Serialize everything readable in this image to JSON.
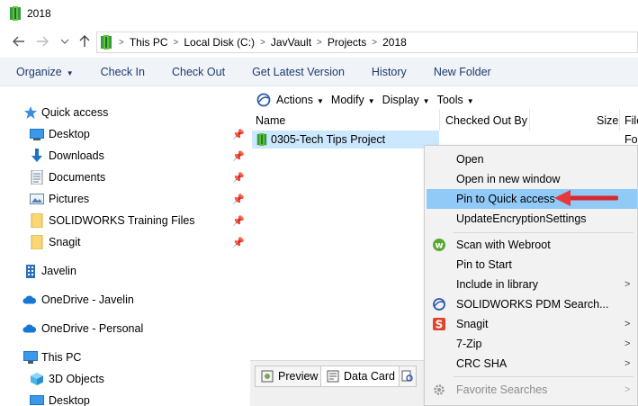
{
  "window": {
    "title": "2018"
  },
  "nav": {
    "back_icon": "back-arrow-icon",
    "forward_icon": "forward-arrow-icon",
    "recent_icon": "chevron-down-icon",
    "up_icon": "up-arrow-icon",
    "breadcrumbs": [
      "This PC",
      "Local Disk (C:)",
      "JavVault",
      "Projects",
      "2018"
    ]
  },
  "toolbar": {
    "organize": "Organize",
    "check_in": "Check In",
    "check_out": "Check Out",
    "get_latest": "Get Latest Version",
    "history": "History",
    "new_folder": "New Folder"
  },
  "sidebar": {
    "quick_access": "Quick access",
    "items": [
      {
        "label": "Desktop",
        "icon": "desktop-icon",
        "pinned": true
      },
      {
        "label": "Downloads",
        "icon": "download-arrow-icon",
        "pinned": true
      },
      {
        "label": "Documents",
        "icon": "documents-icon",
        "pinned": true
      },
      {
        "label": "Pictures",
        "icon": "pictures-icon",
        "pinned": true
      },
      {
        "label": "SOLIDWORKS Training Files",
        "icon": "folder-icon",
        "pinned": true
      },
      {
        "label": "Snagit",
        "icon": "folder-icon",
        "pinned": true
      }
    ],
    "javelin": "Javelin",
    "onedrive_javelin": "OneDrive - Javelin",
    "onedrive_personal": "OneDrive - Personal",
    "this_pc": "This PC",
    "objects_3d": "3D Objects",
    "desktop2": "Desktop"
  },
  "pdm_bar": {
    "actions": "Actions",
    "modify": "Modify",
    "display": "Display",
    "tools": "Tools"
  },
  "columns": {
    "name": "Name",
    "checked_out_by": "Checked Out By",
    "size": "Size",
    "file": "File"
  },
  "rows": [
    {
      "name": "0305-Tech Tips Project",
      "file_type": "Fo"
    }
  ],
  "bottom_tabs": {
    "preview": "Preview",
    "data_card": "Data Card"
  },
  "context_menu": {
    "items": [
      {
        "label": "Open"
      },
      {
        "label": "Open in new window"
      },
      {
        "label": "Pin to Quick access",
        "highlighted": true
      },
      {
        "label": "UpdateEncryptionSettings"
      },
      {
        "label": "Scan with Webroot",
        "icon": "webroot-icon"
      },
      {
        "label": "Pin to Start"
      },
      {
        "label": "Include in library",
        "submenu": true
      },
      {
        "label": "SOLIDWORKS PDM Search...",
        "icon": "pdm-search-icon"
      },
      {
        "label": "Snagit",
        "icon": "snagit-icon",
        "submenu": true
      },
      {
        "label": "7-Zip",
        "submenu": true
      },
      {
        "label": "CRC SHA",
        "submenu": true
      },
      {
        "label": "Favorite Searches",
        "icon": "gear-icon",
        "submenu": true,
        "disabled": true
      }
    ]
  },
  "colors": {
    "accent": "#1e3a6e",
    "selection": "#cce8ff",
    "menu_highlight": "#91c9f7",
    "annotation_arrow": "#e8383d"
  }
}
